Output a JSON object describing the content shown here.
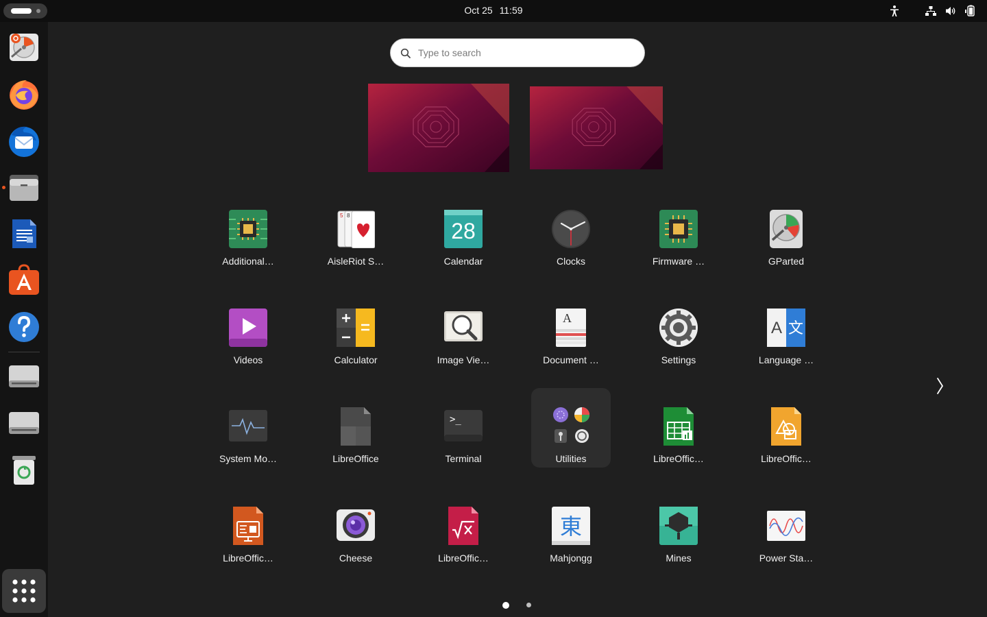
{
  "topbar": {
    "date": "Oct 25",
    "time": "11:59"
  },
  "dock": {
    "items": [
      {
        "name": "Disk Usage Analyzer",
        "icon": "disk-usage-icon"
      },
      {
        "name": "Firefox",
        "icon": "firefox-icon"
      },
      {
        "name": "Thunderbird",
        "icon": "thunderbird-icon"
      },
      {
        "name": "Files",
        "icon": "files-icon"
      },
      {
        "name": "LibreOffice Writer",
        "icon": "writer-icon"
      },
      {
        "name": "App Center",
        "icon": "app-center-icon"
      },
      {
        "name": "Help",
        "icon": "help-icon"
      },
      {
        "name": "Drive 1",
        "icon": "drive-icon"
      },
      {
        "name": "Drive 2",
        "icon": "drive-icon"
      },
      {
        "name": "Trash",
        "icon": "trash-icon"
      }
    ],
    "accent": "#e95420"
  },
  "search": {
    "placeholder": "Type to search"
  },
  "apps": [
    {
      "label": "Additional…",
      "icon": "chip-icon"
    },
    {
      "label": "AisleRiot S…",
      "icon": "cards-icon"
    },
    {
      "label": "Calendar",
      "icon": "calendar-icon",
      "day": "28"
    },
    {
      "label": "Clocks",
      "icon": "clock-icon"
    },
    {
      "label": "Firmware …",
      "icon": "firmware-chip-icon"
    },
    {
      "label": "GParted",
      "icon": "gparted-icon"
    },
    {
      "label": "Videos",
      "icon": "videos-icon"
    },
    {
      "label": "Calculator",
      "icon": "calculator-icon"
    },
    {
      "label": "Image Vie…",
      "icon": "image-viewer-icon"
    },
    {
      "label": "Document …",
      "icon": "document-viewer-icon",
      "glyph": "A"
    },
    {
      "label": "Settings",
      "icon": "settings-gear-icon"
    },
    {
      "label": "Language …",
      "icon": "language-icon",
      "glyph_a": "A",
      "glyph_b": "文"
    },
    {
      "label": "System Mo…",
      "icon": "system-monitor-icon"
    },
    {
      "label": "LibreOffice",
      "icon": "libreoffice-icon"
    },
    {
      "label": "Terminal",
      "icon": "terminal-icon",
      "prompt": ">_"
    },
    {
      "label": "Utilities",
      "icon": "utilities-folder-icon"
    },
    {
      "label": "LibreOffic…",
      "icon": "calc-icon"
    },
    {
      "label": "LibreOffic…",
      "icon": "draw-icon"
    },
    {
      "label": "LibreOffic…",
      "icon": "impress-icon"
    },
    {
      "label": "Cheese",
      "icon": "cheese-icon"
    },
    {
      "label": "LibreOffic…",
      "icon": "math-icon"
    },
    {
      "label": "Mahjongg",
      "icon": "mahjongg-icon",
      "glyph": "東"
    },
    {
      "label": "Mines",
      "icon": "mines-icon"
    },
    {
      "label": "Power Sta…",
      "icon": "power-stats-icon"
    }
  ],
  "pagination": {
    "current": 1,
    "total": 2
  }
}
